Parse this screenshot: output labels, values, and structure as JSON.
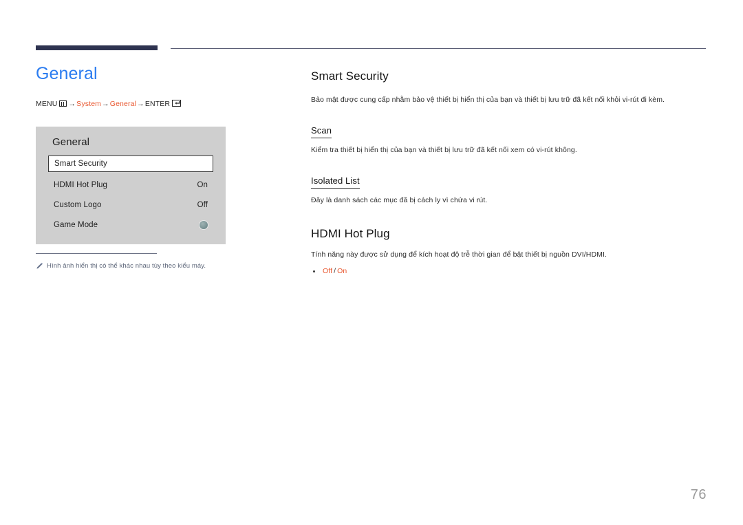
{
  "page": {
    "title": "General",
    "number": "76"
  },
  "breadcrumb": {
    "menu_label": "MENU",
    "menu_icon": "menu-icon",
    "arrow": "→",
    "item1": "System",
    "item2": "General",
    "enter_label": "ENTER",
    "enter_icon": "enter-icon",
    "accent_color": "#e8552d"
  },
  "osd": {
    "title": "General",
    "rows": [
      {
        "label": "Smart Security",
        "value": "",
        "selected": true,
        "control": "none"
      },
      {
        "label": "HDMI Hot Plug",
        "value": "On",
        "selected": false,
        "control": "text"
      },
      {
        "label": "Custom Logo",
        "value": "Off",
        "selected": false,
        "control": "text"
      },
      {
        "label": "Game Mode",
        "value": "",
        "selected": false,
        "control": "dot"
      }
    ]
  },
  "hint": {
    "icon": "pencil-icon",
    "text": "Hình ảnh hiển thị có thể khác nhau tùy theo kiểu máy."
  },
  "content": {
    "smart_security": {
      "heading": "Smart Security",
      "description": "Bảo mật được cung cấp nhằm bảo vệ thiết bị hiển thị của bạn và thiết bị lưu trữ đã kết nối khỏi vi-rút đi kèm.",
      "sub1": {
        "heading": "Scan",
        "description": "Kiểm tra thiết bị hiển thị của bạn và thiết bị lưu trữ đã kết nối xem có vi-rút không."
      },
      "sub2": {
        "heading": "Isolated List",
        "description": "Đây là danh sách các mục đã bị cách ly vì chứa vi rút."
      }
    },
    "hdmi_hot_plug": {
      "heading": "HDMI Hot Plug",
      "description": "Tính năng này được sử dụng để kích hoạt độ trễ thời gian để bật thiết bị nguồn DVI/HDMI.",
      "option_a": "Off",
      "option_sep": "/",
      "option_b": "On"
    }
  }
}
